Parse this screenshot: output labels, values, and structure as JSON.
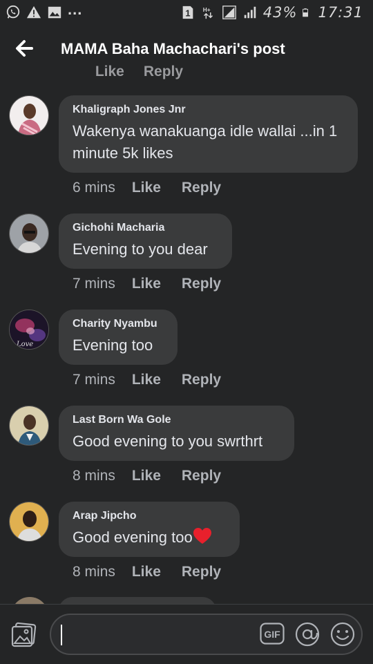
{
  "status_bar": {
    "left_icons": [
      "whatsapp-icon",
      "warning-icon",
      "image-icon"
    ],
    "overflow": "...",
    "right_icons": [
      "sim-1-icon",
      "data-hplus-icon",
      "signal-icon",
      "signal-icon",
      "battery-icon"
    ],
    "sim_label": "1",
    "battery": "43%",
    "time": "17:31"
  },
  "header": {
    "back_icon": "arrow-left-icon",
    "title": "MAMA Baha Machachari's post"
  },
  "cut_off_actions": {
    "like": "Like",
    "reply": "Reply"
  },
  "comments": [
    {
      "author": "Khaligraph Jones Jnr",
      "text": "Wakenya wanakuanga idle wallai ...in 1 minute 5k likes",
      "time": "6 mins",
      "like": "Like",
      "reply": "Reply",
      "avatar_color": "#c96b82"
    },
    {
      "author": "Gichohi Macharia",
      "text": "Evening to you dear",
      "time": "7 mins",
      "like": "Like",
      "reply": "Reply",
      "avatar_color": "#8b8f94"
    },
    {
      "author": "Charity Nyambu",
      "text": "Evening too",
      "time": "7 mins",
      "like": "Like",
      "reply": "Reply",
      "avatar_color": "#3b2a55"
    },
    {
      "author": "Last Born Wa Gole",
      "text": "Good evening to you swrthrt",
      "time": "8 mins",
      "like": "Like",
      "reply": "Reply",
      "avatar_color": "#c9b98e"
    },
    {
      "author": "Arap Jipcho",
      "text": "Good evening too",
      "time": "8 mins",
      "like": "Like",
      "reply": "Reply",
      "avatar_color": "#d8a84a",
      "emoji": "heart-icon"
    }
  ],
  "composer": {
    "photo_icon": "photo-icon",
    "input_value": "",
    "gif_label": "GIF",
    "at_icon": "at-icon",
    "emoji_icon": "emoji-icon"
  },
  "colors": {
    "background": "#242526",
    "bubble": "#3a3b3c",
    "text": "#e4e6eb",
    "secondary_text": "#b0b3b8",
    "heart": "#e8202c"
  }
}
